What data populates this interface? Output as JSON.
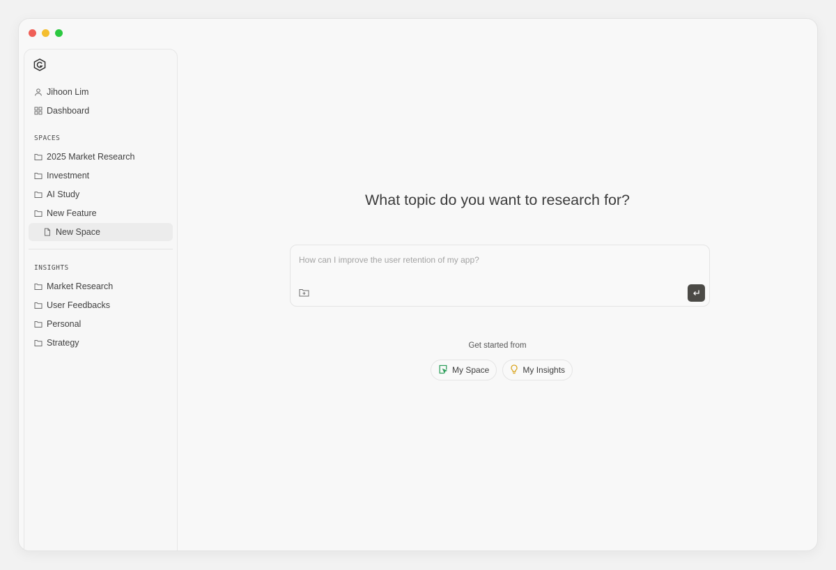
{
  "sidebar": {
    "user": "Jihoon Lim",
    "dashboard": "Dashboard",
    "spaces_title": "SPACES",
    "spaces": [
      "2025 Market Research",
      "Investment",
      "AI Study",
      "New Feature"
    ],
    "active_child": "New Space",
    "insights_title": "INSIGHTS",
    "insights": [
      "Market Research",
      "User Feedbacks",
      "Personal",
      "Strategy"
    ]
  },
  "main": {
    "title": "What topic do you want to research for?",
    "input_placeholder": "How can I improve the user retention of my app?",
    "get_started": "Get started from",
    "chips": [
      "My Space",
      "My Insights"
    ]
  },
  "colors": {
    "send_button": "#4b4a46",
    "my_space_icon": "#2e9e5b",
    "my_insights_icon": "#d9a520"
  }
}
